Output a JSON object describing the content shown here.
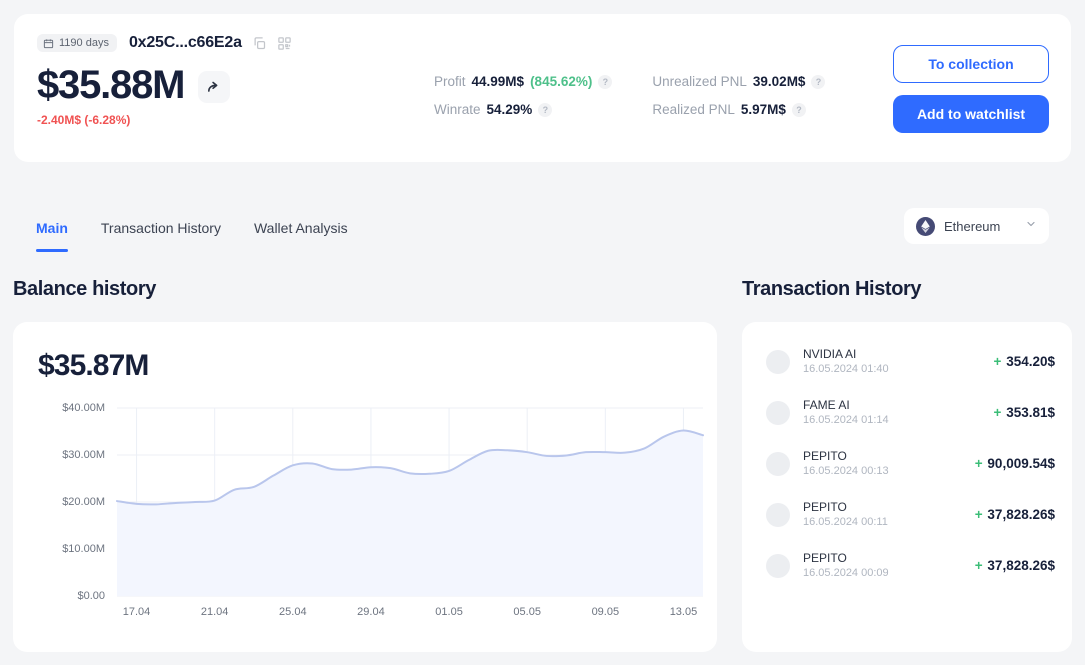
{
  "header": {
    "days_badge": "1190 days",
    "days_icon": "calendar-icon",
    "address": "0x25C...c66E2a",
    "copy_icon": "copy-icon",
    "qr_icon": "qr-code-icon",
    "balance": "$35.88M",
    "share_icon": "share-arrow-icon",
    "delta": "-2.40M$ (-6.28%)",
    "delta_color": "#f05252",
    "stats": [
      {
        "label": "Profit",
        "value": "44.99M$",
        "percent": "(845.62%)",
        "percent_color": "#4ec08a",
        "help": "?"
      },
      {
        "label": "Winrate",
        "value": "54.29%",
        "percent": "",
        "help": "?"
      },
      {
        "label": "Unrealized PNL",
        "value": "39.02M$",
        "percent": "",
        "help": "?"
      },
      {
        "label": "Realized PNL",
        "value": "5.97M$",
        "percent": "",
        "help": "?"
      }
    ],
    "to_collection_label": "To collection",
    "add_watchlist_label": "Add to watchlist",
    "accent_color": "#2f6bff"
  },
  "tabs": [
    {
      "label": "Main",
      "active": true
    },
    {
      "label": "Transaction History",
      "active": false
    },
    {
      "label": "Wallet Analysis",
      "active": false
    }
  ],
  "chain_select": {
    "name": "Ethereum",
    "icon": "ethereum-icon",
    "chevron": "chevron-down-icon"
  },
  "balance_section": {
    "title": "Balance history",
    "current_value": "$35.87M"
  },
  "transactions_section": {
    "title": "Transaction History",
    "items": [
      {
        "name": "NVIDIA AI",
        "date": "16.05.2024 01:40",
        "sign": "+",
        "amount": "354.20$"
      },
      {
        "name": "FAME AI",
        "date": "16.05.2024 01:14",
        "sign": "+",
        "amount": "353.81$"
      },
      {
        "name": "PEPITO",
        "date": "16.05.2024 00:13",
        "sign": "+",
        "amount": "90,009.54$"
      },
      {
        "name": "PEPITO",
        "date": "16.05.2024 00:11",
        "sign": "+",
        "amount": "37,828.26$"
      },
      {
        "name": "PEPITO",
        "date": "16.05.2024 00:09",
        "sign": "+",
        "amount": "37,828.26$"
      }
    ]
  },
  "chart_data": {
    "type": "area",
    "title": "Balance history",
    "xlabel": "",
    "ylabel": "",
    "ylim": [
      0,
      40
    ],
    "yticks": [
      0,
      10,
      20,
      30,
      40
    ],
    "ytick_labels": [
      "$0.00",
      "$10.00M",
      "$20.00M",
      "$30.00M",
      "$40.00M"
    ],
    "xticks": [
      "17.04",
      "21.04",
      "25.04",
      "29.04",
      "01.05",
      "05.05",
      "09.05",
      "13.05"
    ],
    "grid": true,
    "legend": "none",
    "line_color": "#b9c6ec",
    "fill_color": "#f3f6fe",
    "x": [
      "16.04",
      "17.04",
      "18.04",
      "19.04",
      "20.04",
      "21.04",
      "22.04",
      "23.04",
      "24.04",
      "25.04",
      "26.04",
      "27.04",
      "28.04",
      "29.04",
      "30.04",
      "01.05",
      "02.05",
      "03.05",
      "04.05",
      "05.05",
      "06.05",
      "07.05",
      "08.05",
      "09.05",
      "10.05",
      "11.05",
      "12.05",
      "13.05",
      "14.05",
      "15.05",
      "16.05"
    ],
    "values": [
      20.2,
      19.6,
      19.5,
      19.8,
      20.0,
      20.3,
      22.6,
      23.2,
      25.6,
      27.8,
      28.2,
      27.0,
      26.9,
      27.4,
      27.2,
      26.1,
      26.0,
      26.6,
      28.9,
      30.9,
      31.0,
      30.6,
      29.8,
      29.9,
      30.6,
      30.6,
      30.5,
      31.4,
      33.9,
      35.2,
      34.2
    ]
  }
}
